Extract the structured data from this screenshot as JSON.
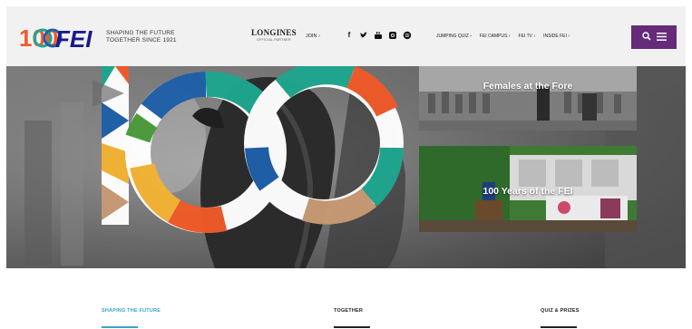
{
  "brand": {
    "logo_text": "FEI",
    "centenary": "100",
    "tagline_1": "SHAPING THE FUTURE",
    "tagline_2": "TOGETHER SINCE 1921"
  },
  "partner": {
    "name": "LONGINES",
    "sub": "OFFICIAL PARTNER"
  },
  "nav": {
    "join": "JOIN",
    "links": [
      "JUMPING QUIZ",
      "FEI CAMPUS",
      "FEI TV",
      "INSIDE FEI"
    ]
  },
  "tiles": [
    {
      "title": "Females at the Fore"
    },
    {
      "title": "100 Years of the FEI"
    }
  ],
  "tabs": [
    {
      "label": "SHAPING THE FUTURE"
    },
    {
      "label": "TOGETHER"
    },
    {
      "label": "QUIZ & PRIZES"
    }
  ],
  "colors": {
    "accent": "#662a7a",
    "tab_active": "#3aa3c9",
    "orange": "#f05a28",
    "teal": "#1fa68f",
    "blue": "#1f5fa8",
    "yellow": "#f2b233",
    "tan": "#c79a73",
    "green": "#4a9a3a"
  }
}
